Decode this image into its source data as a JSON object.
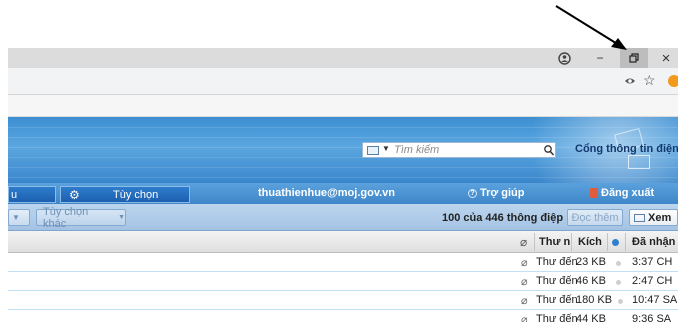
{
  "browser": {
    "minimize": "−",
    "restore": "⧉",
    "close": "×",
    "star": "☆"
  },
  "banner": {
    "search_placeholder": "Tìm kiếm",
    "portal_text": "Cổng thông tin điện t"
  },
  "nav": {
    "tab_left_label": "u",
    "tab_options_label": "Tùy chọn",
    "user_email": "thuathienhue@moj.gov.vn",
    "help_label": "Trợ giúp",
    "logout_label": "Đăng xuất"
  },
  "toolbar": {
    "more_options_label": "Tùy chọn khác",
    "message_count": "100 của 446 thông điệp",
    "read_more_label": "Đọc thêm",
    "view_label": "Xem"
  },
  "table": {
    "headers": {
      "from": "Thư n",
      "size": "Kích",
      "received": "Đã nhận"
    },
    "rows": [
      {
        "from": "Thư đến",
        "size": "23 KB",
        "received": "3:37 CH"
      },
      {
        "from": "Thư đến",
        "size": "46 KB",
        "received": "2:47 CH"
      },
      {
        "from": "Thư đến",
        "size": "180 KB",
        "received": "10:47 SA"
      },
      {
        "from": "Thư đến",
        "size": "44 KB",
        "received": "9:36 SA"
      }
    ]
  },
  "colors": {
    "banner": "#3d8fd2",
    "nav": "#3e86c8",
    "toolbar": "#a4c3e4"
  }
}
